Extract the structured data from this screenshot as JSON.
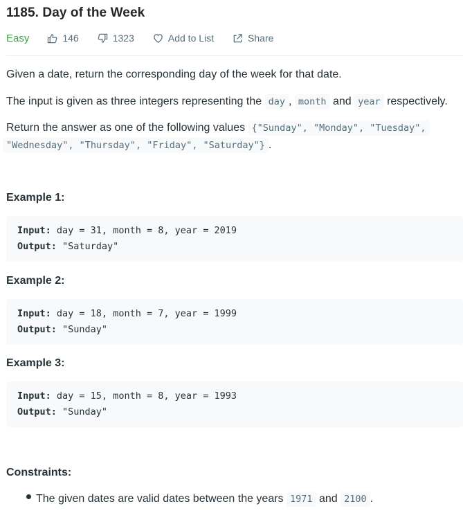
{
  "problem": {
    "title": "1185. Day of the Week",
    "difficulty": "Easy",
    "likes": "146",
    "dislikes": "1323",
    "add_to_list": "Add to List",
    "share": "Share"
  },
  "description": {
    "p1": "Given a date, return the corresponding day of the week for that date.",
    "p2_prefix": "The input is given as three integers representing the",
    "p2_code1": "day",
    "p2_sep1": ",",
    "p2_code2": "month",
    "p2_and": "and",
    "p2_code3": "year",
    "p2_suffix": "respectively.",
    "p3_prefix": "Return the answer as one of the following values",
    "p3_code_line1": "{\"Sunday\", \"Monday\", \"Tuesday\",",
    "p3_code_line2": "\"Wednesday\", \"Thursday\", \"Friday\", \"Saturday\"}",
    "p3_suffix": "."
  },
  "examples": [
    {
      "heading": "Example 1:",
      "input_label": "Input:",
      "input": " day = 31, month = 8, year = 2019",
      "output_label": "Output:",
      "output": " \"Saturday\""
    },
    {
      "heading": "Example 2:",
      "input_label": "Input:",
      "input": " day = 18, month = 7, year = 1999",
      "output_label": "Output:",
      "output": " \"Sunday\""
    },
    {
      "heading": "Example 3:",
      "input_label": "Input:",
      "input": " day = 15, month = 8, year = 1993",
      "output_label": "Output:",
      "output": " \"Sunday\""
    }
  ],
  "constraints": {
    "heading": "Constraints:",
    "item_prefix": "The given dates are valid dates between the years",
    "item_code1": "1971",
    "item_and": "and",
    "item_code2": "2100",
    "item_suffix": "."
  },
  "colors": {
    "difficulty_easy": "#43a047",
    "meta_text": "#546e7a",
    "code_bg": "#f7f9fa"
  }
}
